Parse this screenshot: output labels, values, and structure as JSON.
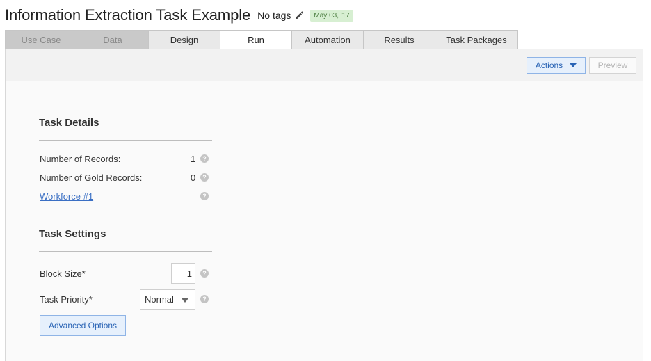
{
  "header": {
    "title": "Information Extraction Task Example",
    "tags": "No tags",
    "date_badge": "May 03, '17"
  },
  "tabs": [
    {
      "label": "Use Case",
      "state": "disabled"
    },
    {
      "label": "Data",
      "state": "disabled"
    },
    {
      "label": "Design",
      "state": "normal"
    },
    {
      "label": "Run",
      "state": "active"
    },
    {
      "label": "Automation",
      "state": "normal"
    },
    {
      "label": "Results",
      "state": "normal"
    },
    {
      "label": "Task Packages",
      "state": "normal"
    }
  ],
  "toolbar": {
    "actions_label": "Actions",
    "preview_label": "Preview"
  },
  "task_details": {
    "title": "Task Details",
    "records_label": "Number of Records:",
    "records_value": "1",
    "gold_label": "Number of Gold Records:",
    "gold_value": "0",
    "workforce_link": "Workforce #1"
  },
  "task_settings": {
    "title": "Task Settings",
    "block_size_label": "Block Size*",
    "block_size_value": "1",
    "priority_label": "Task Priority*",
    "priority_value": "Normal",
    "advanced_button": "Advanced Options"
  },
  "icons": {
    "help": "?",
    "edit": "pencil-icon",
    "dropdown": "caret-down-icon"
  },
  "colors": {
    "accent": "#2a64b5",
    "badge_bg": "#d7efd2",
    "badge_text": "#4a7c3f",
    "link": "#3a6fc4"
  }
}
